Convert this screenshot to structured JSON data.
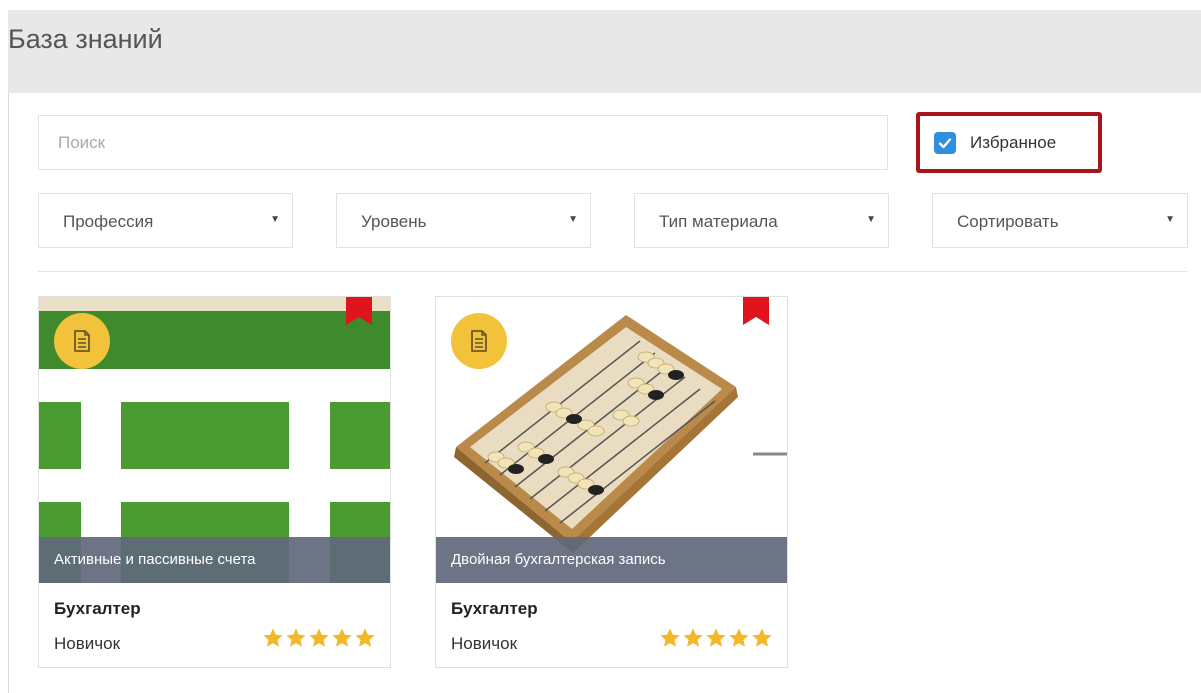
{
  "header": {
    "title": "База знаний"
  },
  "search": {
    "placeholder": "Поиск",
    "value": ""
  },
  "favorites": {
    "label": "Избранное",
    "checked": true
  },
  "filters": [
    {
      "label": "Профессия"
    },
    {
      "label": "Уровень"
    },
    {
      "label": "Тип материала"
    },
    {
      "label": "Сортировать"
    }
  ],
  "cards": [
    {
      "title": "Активные и пассивные счета",
      "profession": "Бухгалтер",
      "level": "Новичок",
      "rating": 5,
      "bookmarked": true,
      "icon": "document-icon",
      "image": "green-grid-illustration"
    },
    {
      "title": "Двойная бухгалтерская запись",
      "profession": "Бухгалтер",
      "level": "Новичок",
      "rating": 5,
      "bookmarked": true,
      "icon": "document-icon",
      "image": "abacus-photo"
    }
  ],
  "colors": {
    "accent_checkbox": "#2d8fde",
    "highlight_border": "#a8161b",
    "badge": "#f3c23b",
    "star": "#f3b82a",
    "bookmark": "#e0141d",
    "caption_bg": "#60687c"
  }
}
